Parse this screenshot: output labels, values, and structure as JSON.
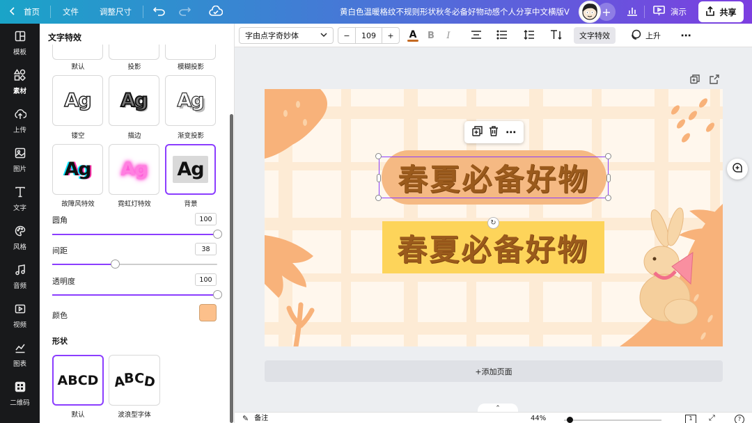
{
  "topbar": {
    "home": "首页",
    "file": "文件",
    "resize": "调整尺寸",
    "doc_title": "黄白色温暖格纹不规则形状秋冬必备好物动感个人分享中文横版Vl...",
    "present": "演示",
    "share": "共享"
  },
  "rail": {
    "items": [
      {
        "label": "模板",
        "icon": "template-icon"
      },
      {
        "label": "素材",
        "icon": "elements-icon"
      },
      {
        "label": "上传",
        "icon": "upload-icon"
      },
      {
        "label": "图片",
        "icon": "photo-icon"
      },
      {
        "label": "文字",
        "icon": "text-icon"
      },
      {
        "label": "风格",
        "icon": "palette-icon"
      },
      {
        "label": "音频",
        "icon": "music-icon"
      },
      {
        "label": "视频",
        "icon": "video-icon"
      },
      {
        "label": "图表",
        "icon": "chart-icon"
      },
      {
        "label": "二维码",
        "icon": "qrcode-icon"
      }
    ]
  },
  "panel": {
    "title": "文字特效",
    "effects_row0": [
      "默认",
      "投影",
      "模糊投影"
    ],
    "effects_row1": [
      "镂空",
      "描边",
      "渐变投影"
    ],
    "effects_row2": [
      "故障风特效",
      "霓虹灯特效",
      "背景"
    ],
    "sample": "Ag",
    "props": {
      "roundness_label": "圆角",
      "roundness": "100",
      "roundness_pct": 100,
      "spacing_label": "间距",
      "spacing": "38",
      "spacing_pct": 38,
      "opacity_label": "透明度",
      "opacity": "100",
      "opacity_pct": 100,
      "color_label": "颜色",
      "color": "#fcc08b"
    },
    "shape_title": "形状",
    "shapes": [
      {
        "label": "默认",
        "sample": "ABCD"
      },
      {
        "label": "波浪型字体",
        "sample": "ABCD"
      }
    ]
  },
  "toolbar": {
    "font": "字由点字奇妙体",
    "minus": "−",
    "size": "109",
    "plus": "+",
    "effects": "文字特效",
    "position": "上升",
    "text_color": "#c46a22"
  },
  "canvas": {
    "heading_top": "春夏必备好物",
    "heading_bottom": "春夏必备好物",
    "add_page": "+添加页面"
  },
  "bottom": {
    "notes": "备注",
    "zoom": "44%",
    "page": "1"
  }
}
